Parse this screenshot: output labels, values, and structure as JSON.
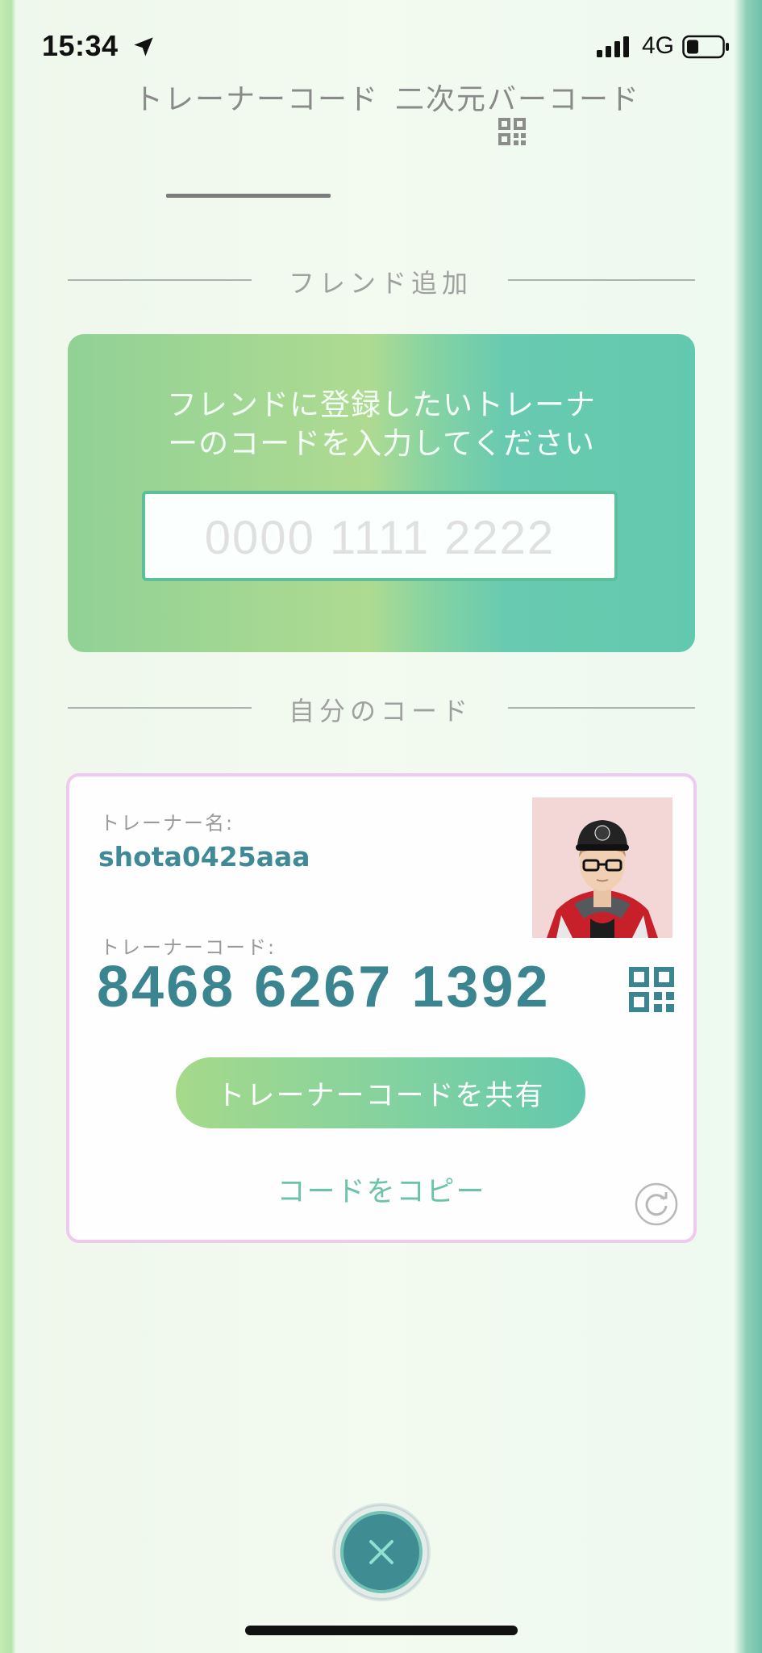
{
  "status_bar": {
    "time": "15:34",
    "network": "4G"
  },
  "tabs": [
    {
      "label": "トレーナーコード",
      "selected": true
    },
    {
      "label": "二次元バーコード",
      "selected": false
    }
  ],
  "friend_add": {
    "title": "フレンド追加",
    "prompt_line1": "フレンドに登録したいトレーナ",
    "prompt_line2": "ーのコードを入力してください",
    "input_placeholder": "0000 1111 2222"
  },
  "my_code": {
    "title": "自分のコード",
    "name_label": "トレーナー名:",
    "name": "shota0425aaa",
    "code_label": "トレーナーコード:",
    "code": "8468 6267 1392",
    "share_button": "トレーナーコードを共有",
    "copy_link": "コードをコピー"
  },
  "colors": {
    "accent": "#3b8591",
    "card_border": "#efc9ef",
    "green_start": "#a6d98a",
    "green_end": "#62c8ad"
  },
  "icons": [
    "location-arrow-icon",
    "signal-icon",
    "battery-icon",
    "qr-code-icon",
    "refresh-icon",
    "close-icon"
  ]
}
